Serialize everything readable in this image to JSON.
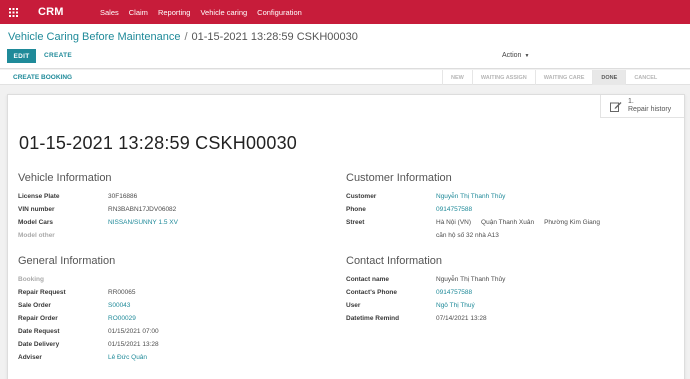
{
  "app": {
    "brand": "CRM"
  },
  "nav": {
    "items": [
      "Sales",
      "Claim",
      "Reporting",
      "Vehicle caring",
      "Configuration"
    ]
  },
  "breadcrumb": {
    "parent": "Vehicle Caring Before Maintenance",
    "separator": "/",
    "current": "01-15-2021 13:28:59 CSKH00030"
  },
  "buttons": {
    "edit": "EDIT",
    "create": "CREATE",
    "action": "Action",
    "create_booking": "CREATE BOOKING"
  },
  "stages": [
    "NEW",
    "WAITING ASSIGN",
    "WAITING CARE",
    "DONE",
    "CANCEL"
  ],
  "active_stage": "DONE",
  "smart_button": {
    "count": "1.",
    "label": "Repair history"
  },
  "record": {
    "title": "01-15-2021 13:28:59 CSKH00030"
  },
  "vehicle": {
    "heading": "Vehicle Information",
    "license_plate_label": "License Plate",
    "license_plate": "30F16886",
    "vin_label": "VIN number",
    "vin": "RN3BABN17JDV06082",
    "model_label": "Model Cars",
    "model": "NISSAN/SUNNY 1.5 XV",
    "model_other_label": "Model other"
  },
  "customer": {
    "heading": "Customer Information",
    "customer_label": "Customer",
    "customer": "Nguyễn Thị Thanh Thủy",
    "phone_label": "Phone",
    "phone": "0914757588",
    "street_label": "Street",
    "street_city": "Hà Nội (VN)",
    "street_district": "Quận Thanh Xuân",
    "street_ward": "Phường Kim Giang",
    "street_line": "căn hộ số 32 nhà A13"
  },
  "general": {
    "heading": "General Information",
    "booking_label": "Booking",
    "repair_request_label": "Repair Request",
    "repair_request": "RR00065",
    "sale_order_label": "Sale Order",
    "sale_order": "S00043",
    "repair_order_label": "Repair Order",
    "repair_order": "RO00029",
    "date_request_label": "Date Request",
    "date_request": "01/15/2021 07:00",
    "date_delivery_label": "Date Delivery",
    "date_delivery": "01/15/2021 13:28",
    "adviser_label": "Adviser",
    "adviser": "Lê Đức Quân"
  },
  "contact": {
    "heading": "Contact Information",
    "name_label": "Contact name",
    "name": "Nguyễn Thị Thanh Thủy",
    "phone_label": "Contact's Phone",
    "phone": "0914757588",
    "user_label": "User",
    "user": "Ngô Thị Thuý",
    "remind_label": "Datetime Remind",
    "remind": "07/14/2021 13:28"
  },
  "colors": {
    "brand_bar": "#c71c3a",
    "primary": "#1f8a99"
  },
  "icons": {
    "apps": "apps-grid-icon",
    "caret": "caret-down-icon",
    "smart_button": "edit-note-icon"
  }
}
